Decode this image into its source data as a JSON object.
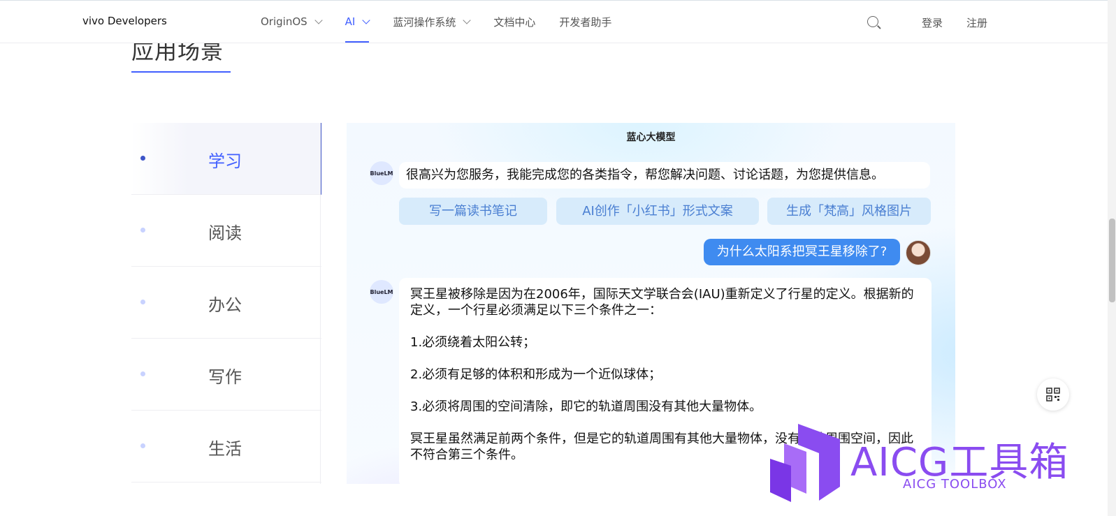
{
  "nav": {
    "brand": "vivo Developers",
    "items": [
      {
        "label": "OriginOS",
        "has_dropdown": true,
        "active": false
      },
      {
        "label": "AI",
        "has_dropdown": true,
        "active": true
      },
      {
        "label": "蓝河操作系统",
        "has_dropdown": true,
        "active": false
      },
      {
        "label": "文档中心",
        "has_dropdown": false,
        "active": false
      },
      {
        "label": "开发者助手",
        "has_dropdown": false,
        "active": false
      }
    ],
    "search_icon": "search-icon",
    "login": "登录",
    "register": "注册",
    "accent_color": "#415fff"
  },
  "section": {
    "title": "应用场景"
  },
  "tabs": [
    {
      "label": "学习",
      "active": true
    },
    {
      "label": "阅读",
      "active": false
    },
    {
      "label": "办公",
      "active": false
    },
    {
      "label": "写作",
      "active": false
    },
    {
      "label": "生活",
      "active": false
    }
  ],
  "chat": {
    "title": "蓝心大模型",
    "bot_avatar": "BlueLM",
    "greeting": "很高兴为您服务，我能完成您的各类指令，帮您解决问题、讨论话题，为您提供信息。",
    "suggestions": [
      "写一篇读书笔记",
      "AI创作「小红书」形式文案",
      "生成「梵高」风格图片"
    ],
    "user_message": "为什么太阳系把冥王星移除了?",
    "answer": [
      "冥王星被移除是因为在2006年，国际天文学联合会(IAU)重新定义了行星的定义。根据新的定义，一个行星必须满足以下三个条件之一：",
      "1.必须绕着太阳公转；",
      "2.必须有足够的体积和形成为一个近似球体；",
      "3.必须将周围的空间清除，即它的轨道周围没有其他大量物体。",
      "冥王星虽然满足前两个条件，但是它的轨道周围有其他大量物体，没有清除周围空间，因此不符合第三个条件。"
    ],
    "user_bubble_color": "#3f8bf0"
  },
  "float": {
    "qr_icon": "qr-code-icon"
  },
  "watermark": {
    "title": "AICG工具箱",
    "subtitle": "AICG TOOLBOX",
    "color": "#8a4cf0"
  }
}
